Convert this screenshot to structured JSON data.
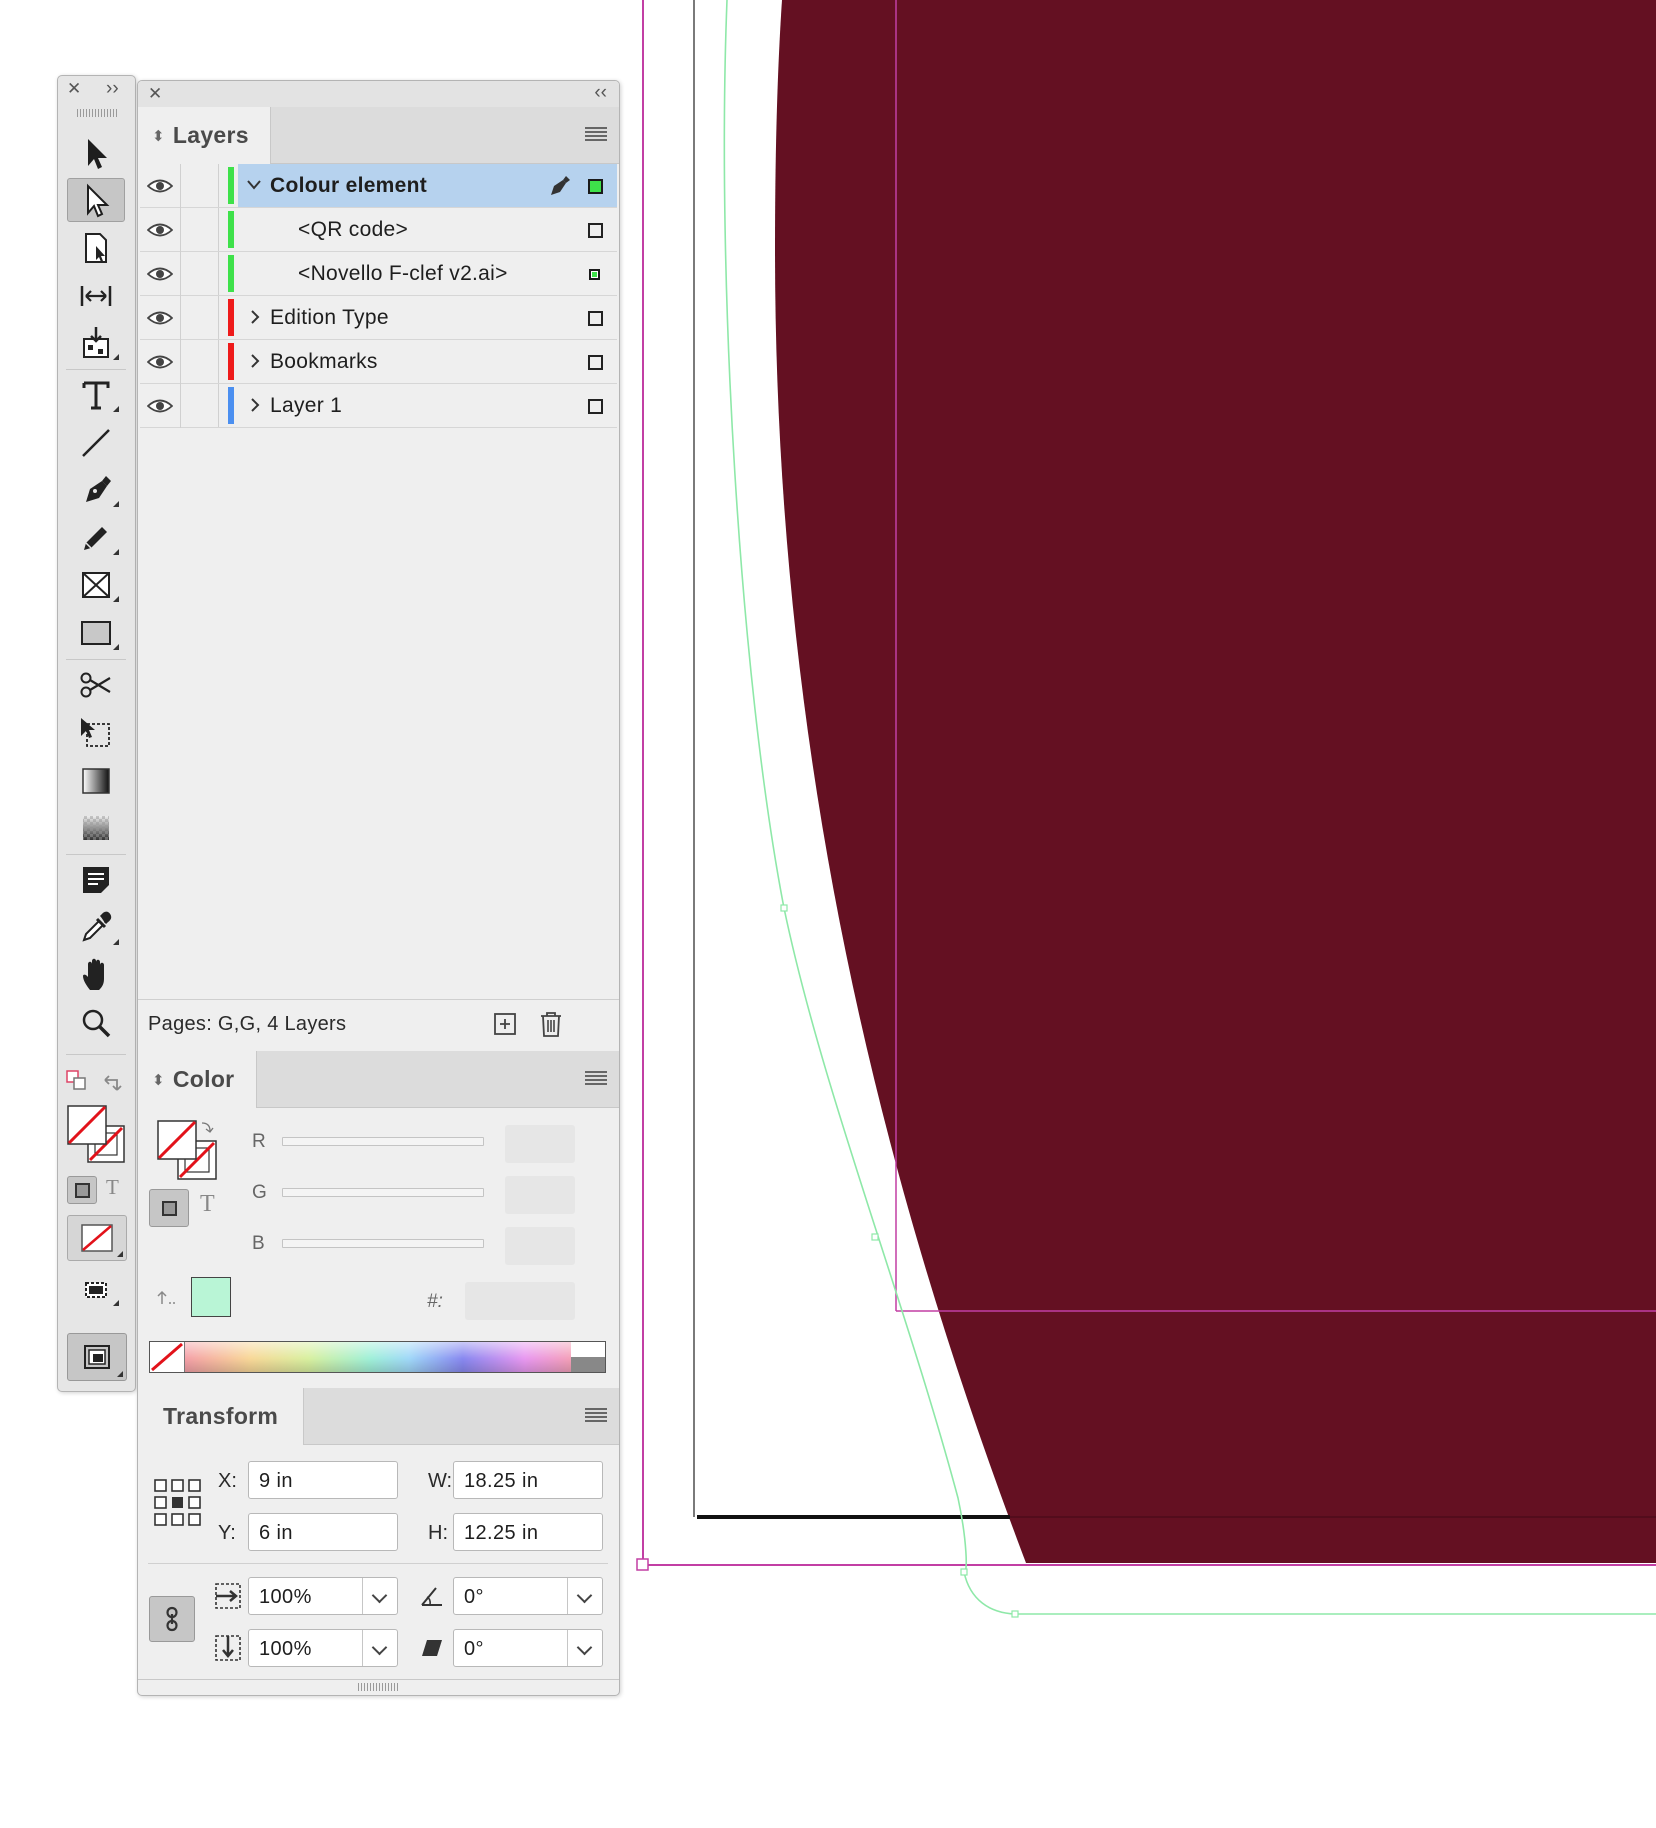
{
  "toolbox": {
    "close_glyph": "✕",
    "collapse_glyph": "››",
    "tools": [
      {
        "name": "selection-tool",
        "icon": "black-arrow-icon"
      },
      {
        "name": "direct-selection-tool",
        "icon": "white-arrow-icon",
        "selected": true
      },
      {
        "name": "page-tool",
        "icon": "page-icon"
      },
      {
        "name": "gap-tool",
        "icon": "gap-icon"
      },
      {
        "name": "content-collector-tool",
        "icon": "collector-icon"
      },
      {
        "name": "type-tool",
        "icon": "type-icon"
      },
      {
        "name": "line-tool",
        "icon": "line-icon"
      },
      {
        "name": "pen-tool",
        "icon": "pen-icon"
      },
      {
        "name": "pencil-tool",
        "icon": "pencil-icon"
      },
      {
        "name": "rectangle-frame-tool",
        "icon": "frame-icon"
      },
      {
        "name": "rectangle-tool",
        "icon": "rectangle-icon"
      },
      {
        "name": "scissors-tool",
        "icon": "scissors-icon"
      },
      {
        "name": "free-transform-tool",
        "icon": "free-transform-icon"
      },
      {
        "name": "gradient-swatch-tool",
        "icon": "gradient-icon"
      },
      {
        "name": "gradient-feather-tool",
        "icon": "feather-icon"
      },
      {
        "name": "note-tool",
        "icon": "note-icon"
      },
      {
        "name": "eyedropper-tool",
        "icon": "eyedropper-icon"
      },
      {
        "name": "hand-tool",
        "icon": "hand-icon"
      },
      {
        "name": "zoom-tool",
        "icon": "zoom-icon"
      }
    ],
    "type_glyph": "T"
  },
  "dock": {
    "close_glyph": "✕",
    "collapse_glyph": "‹‹"
  },
  "layers_panel": {
    "tab_label": "Layers",
    "rows": [
      {
        "name": "Colour element",
        "color": "#3ee14a",
        "expanded": true,
        "selected": true,
        "indent": 0
      },
      {
        "name": "<QR code>",
        "color": "#3ee14a",
        "indent": 1
      },
      {
        "name": "<Novello F-clef v2.ai>",
        "color": "#3ee14a",
        "indent": 1
      },
      {
        "name": "Edition Type",
        "color": "#ee1a1a",
        "indent": 0
      },
      {
        "name": "Bookmarks",
        "color": "#ee1a1a",
        "indent": 0
      },
      {
        "name": "Layer 1",
        "color": "#4b8ff0",
        "indent": 0
      }
    ],
    "footer_text": "Pages: G,G, 4 Layers"
  },
  "color_panel": {
    "tab_label": "Color",
    "channels": [
      "R",
      "G",
      "B"
    ],
    "hex_label": "#:",
    "type_glyph": "T",
    "swatch_color": "#b9f5d6"
  },
  "transform_panel": {
    "tab_label": "Transform",
    "x_label": "X:",
    "x_value": "9 in",
    "y_label": "Y:",
    "y_value": "6 in",
    "w_label": "W:",
    "w_value": "18.25 in",
    "h_label": "H:",
    "h_value": "12.25 in",
    "scale_x": "100%",
    "scale_y": "100%",
    "rotation": "0°",
    "shear": "0°"
  },
  "canvas": {
    "shape_color": "#641022",
    "margin_color": "#c23fa4",
    "bleed_color": "#8ee8a8"
  }
}
